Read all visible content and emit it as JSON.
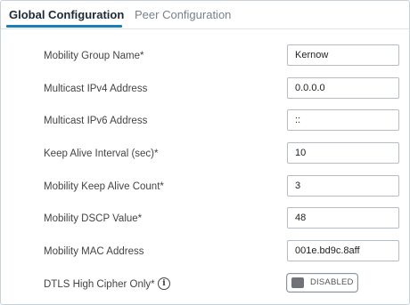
{
  "tabs": {
    "global": "Global Configuration",
    "peer": "Peer Configuration"
  },
  "fields": [
    {
      "label": "Mobility Group Name*",
      "value": "Kernow"
    },
    {
      "label": "Multicast IPv4 Address",
      "value": "0.0.0.0"
    },
    {
      "label": "Multicast IPv6 Address",
      "value": "::"
    },
    {
      "label": "Keep Alive Interval (sec)*",
      "value": "10"
    },
    {
      "label": "Mobility Keep Alive Count*",
      "value": "3"
    },
    {
      "label": "Mobility DSCP Value*",
      "value": "48"
    },
    {
      "label": "Mobility MAC Address",
      "value": "001e.bd9c.8aff"
    }
  ],
  "dtls": {
    "label": "DTLS High Cipher Only*",
    "info_icon": "info-icon",
    "info_glyph": "i",
    "toggle_state": "DISABLED"
  },
  "colors": {
    "active_tab_underline": "#1b7fb8",
    "toggle_knob": "#6f7378"
  }
}
